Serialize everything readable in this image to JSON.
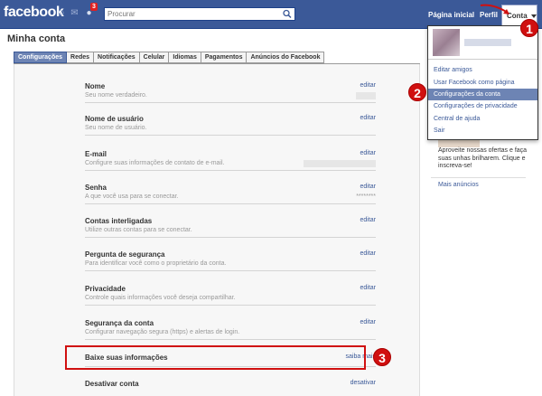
{
  "topbar": {
    "logo": "facebook",
    "notification_count": "3",
    "search_placeholder": "Procurar",
    "nav_home": "Página inicial",
    "nav_profile": "Perfil",
    "nav_account": "Conta"
  },
  "page": {
    "title": "Minha conta"
  },
  "tabs": [
    {
      "label": "Configurações",
      "active": true
    },
    {
      "label": "Redes"
    },
    {
      "label": "Notificações"
    },
    {
      "label": "Celular"
    },
    {
      "label": "Idiomas"
    },
    {
      "label": "Pagamentos"
    },
    {
      "label": "Anúncios do Facebook"
    }
  ],
  "settings": [
    {
      "title": "Nome",
      "desc": "Seu nome verdadeiro.",
      "action": "editar"
    },
    {
      "title": "Nome de usuário",
      "desc": "Seu nome de usuário.",
      "action": "editar"
    },
    {
      "title": "E-mail",
      "desc": "Configure suas informações de contato de e-mail.",
      "action": "editar"
    },
    {
      "title": "Senha",
      "desc": "A que você usa para se conectar.",
      "action": "editar",
      "value": "********"
    },
    {
      "title": "Contas interligadas",
      "desc": "Utilize outras contas para se conectar.",
      "action": "editar"
    },
    {
      "title": "Pergunta de segurança",
      "desc": "Para identificar você como o proprietário da conta.",
      "action": "editar"
    },
    {
      "title": "Privacidade",
      "desc": "Controle quais informações você deseja compartilhar.",
      "action": "editar"
    },
    {
      "title": "Segurança da conta",
      "desc": "Configurar navegação segura (https) e alertas de login.",
      "action": "editar"
    },
    {
      "title": "Baixe suas informações",
      "desc": "",
      "action": "saiba mais"
    },
    {
      "title": "Desativar conta",
      "desc": "",
      "action": "desativar"
    }
  ],
  "account_menu": {
    "items": [
      "Editar amigos",
      "Usar Facebook como página",
      "Configurações da conta",
      "Configurações de privacidade",
      "Central de ajuda",
      "Sair"
    ]
  },
  "sidebar": {
    "ad_text": "Aproveite nossas ofertas e faça suas unhas brilharem. Clique e inscreva-se!",
    "more_ads": "Mais anúncios"
  },
  "annotations": {
    "step1": "1",
    "step2": "2",
    "step3": "3"
  },
  "colors": {
    "brand_blue": "#3b5998",
    "highlight_red": "#d01010"
  }
}
